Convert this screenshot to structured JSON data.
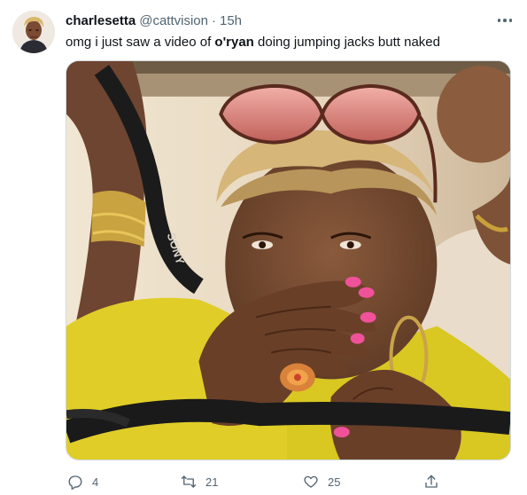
{
  "tweet": {
    "display_name": "charlesetta",
    "handle": "@cattvision",
    "separator": "·",
    "time": "15h",
    "text_before": "omg i just saw a video of ",
    "text_bold": "o'ryan",
    "text_after": " doing jumping jacks butt naked",
    "media_strap_text": "SONY",
    "counts": {
      "replies": "4",
      "retweets": "21",
      "likes": "25"
    }
  },
  "icons": {
    "more": "more-horizontal-icon",
    "reply": "reply-icon",
    "retweet": "retweet-icon",
    "like": "heart-icon",
    "share": "share-icon"
  },
  "colors": {
    "text_primary": "#0f1419",
    "text_secondary": "#536471",
    "border": "#cfd9de",
    "nail_polish": "#f0529a",
    "shirt_yellow": "#e6d22a"
  }
}
